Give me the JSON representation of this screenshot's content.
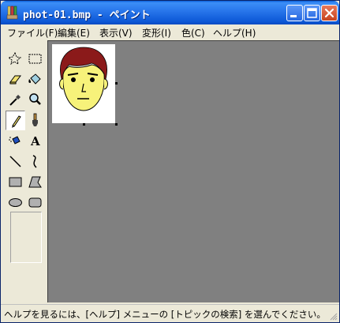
{
  "window": {
    "title": "phot-01.bmp - ペイント"
  },
  "title_buttons": {
    "minimize": "minimize-icon",
    "maximize": "maximize-icon",
    "close": "close-icon"
  },
  "menu": {
    "items": [
      {
        "label": "ファイル(F)"
      },
      {
        "label": "編集(E)"
      },
      {
        "label": "表示(V)"
      },
      {
        "label": "変形(I)"
      },
      {
        "label": "色(C)"
      },
      {
        "label": "ヘルプ(H)"
      }
    ]
  },
  "toolbox": {
    "tools": [
      "free-form-select-icon",
      "rectangle-select-icon",
      "eraser-icon",
      "fill-bucket-icon",
      "color-picker-icon",
      "magnifier-icon",
      "pencil-icon",
      "brush-icon",
      "airbrush-icon",
      "text-icon",
      "line-icon",
      "curve-icon",
      "rectangle-icon",
      "polygon-icon",
      "ellipse-icon",
      "rounded-rectangle-icon"
    ],
    "active": "pencil-icon",
    "text_tool_glyph": "A"
  },
  "canvas": {
    "drawing": "face-drawing",
    "colors": {
      "hair": "#8b1a1a",
      "face": "#f7f27a",
      "background": "#ffffff"
    }
  },
  "status": {
    "text": "ヘルプを見るには、[ヘルプ] メニューの [トピックの検索] を選んでください。"
  },
  "colors": {
    "titlebar": "#2a78ec",
    "workspace": "#808080",
    "chrome": "#ece9d8"
  }
}
